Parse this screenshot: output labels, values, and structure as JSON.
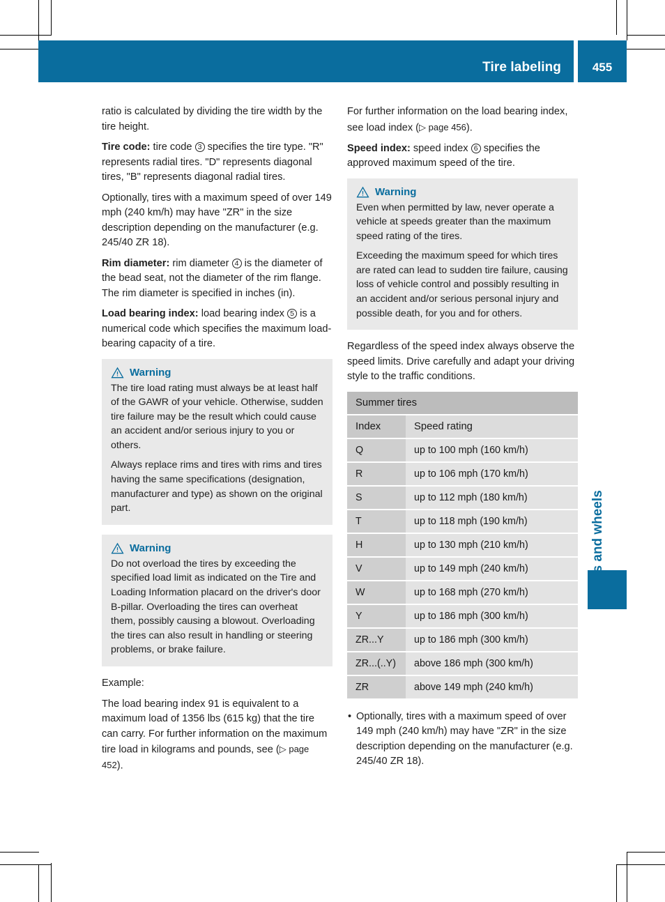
{
  "header": {
    "title": "Tire labeling",
    "page_number": "455",
    "accent_color": "#0a6d9e"
  },
  "side_tab": {
    "label": "Tires and wheels"
  },
  "left_column": {
    "para_ratio": "ratio is calculated by dividing the tire width by the tire height.",
    "tire_code_label": "Tire code:",
    "tire_code_text_a": " tire code ",
    "tire_code_marker": "3",
    "tire_code_text_b": " specifies the tire type. \"R\" represents radial tires. \"D\" represents diagonal tires, \"B\" represents diagonal radial tires.",
    "para_optional": "Optionally, tires with a maximum speed of over 149 mph (240 km/h) may have \"ZR\" in the size description depending on the manufacturer (e.g. 245/40 ZR 18).",
    "rim_label": "Rim diameter:",
    "rim_text_a": " rim diameter ",
    "rim_marker": "4",
    "rim_text_b": " is the diameter of the bead seat, not the diameter of the rim flange. The rim diameter is specified in inches (in).",
    "load_label": "Load bearing index:",
    "load_text_a": " load bearing index ",
    "load_marker": "5",
    "load_text_b": " is a numerical code which specifies the maximum load-bearing capacity of a tire.",
    "warning1": {
      "title": "Warning",
      "paragraphs": [
        "The tire load rating must always be at least half of the GAWR of your vehicle. Otherwise, sudden tire failure may be the result which could cause an accident and/or serious injury to you or others.",
        "Always replace rims and tires with rims and tires having the same specifications (designation, manufacturer and type) as shown on the original part."
      ]
    },
    "warning2": {
      "title": "Warning",
      "paragraphs": [
        "Do not overload the tires by exceeding the specified load limit as indicated on the Tire and Loading Information placard on the driver's door B-pillar. Overloading the tires can overheat them, possibly causing a blowout. Overloading the tires can also result in handling or steering problems, or brake failure."
      ]
    },
    "example_label": "Example:",
    "example_text_a": "The load bearing index 91 is equivalent to a maximum load of 1356 lbs (615 kg) that the tire can carry. For further information on the maximum tire load in kilograms and pounds, see (",
    "example_ref": "▷ page 452",
    "example_text_b": ")."
  },
  "right_column": {
    "para_further_a": "For further information on the load bearing index, see load index (",
    "para_further_ref": "▷ page 456",
    "para_further_b": ").",
    "speed_label": "Speed index:",
    "speed_text_a": " speed index ",
    "speed_marker": "6",
    "speed_text_b": " specifies the approved maximum speed of the tire.",
    "warning3": {
      "title": "Warning",
      "paragraphs": [
        "Even when permitted by law, never operate a vehicle at speeds greater than the maximum speed rating of the tires.",
        "Exceeding the maximum speed for which tires are rated can lead to sudden tire failure, causing loss of vehicle control and possibly resulting in an accident and/or serious personal injury and possible death, for you and for others."
      ]
    },
    "para_regardless": "Regardless of the speed index always observe the speed limits. Drive carefully and adapt your driving style to the traffic conditions.",
    "table": {
      "caption": "Summer tires",
      "headers": [
        "Index",
        "Speed rating"
      ],
      "rows": [
        [
          "Q",
          "up to 100 mph (160 km/h)"
        ],
        [
          "R",
          "up to 106 mph (170 km/h)"
        ],
        [
          "S",
          "up to 112 mph (180 km/h)"
        ],
        [
          "T",
          "up to 118 mph (190 km/h)"
        ],
        [
          "H",
          "up to 130 mph (210 km/h)"
        ],
        [
          "V",
          "up to 149 mph (240 km/h)"
        ],
        [
          "W",
          "up to 168 mph (270 km/h)"
        ],
        [
          "Y",
          "up to 186 mph (300 km/h)"
        ],
        [
          "ZR...Y",
          "up to 186 mph (300 km/h)"
        ],
        [
          "ZR...(..Y)",
          "above 186 mph (300 km/h)"
        ],
        [
          "ZR",
          "above 149 mph (240 km/h)"
        ]
      ]
    },
    "bullets": [
      "Optionally, tires with a maximum speed of over 149 mph (240 km/h) may have \"ZR\" in the size description depending on the manufacturer (e.g. 245/40 ZR 18)."
    ]
  }
}
